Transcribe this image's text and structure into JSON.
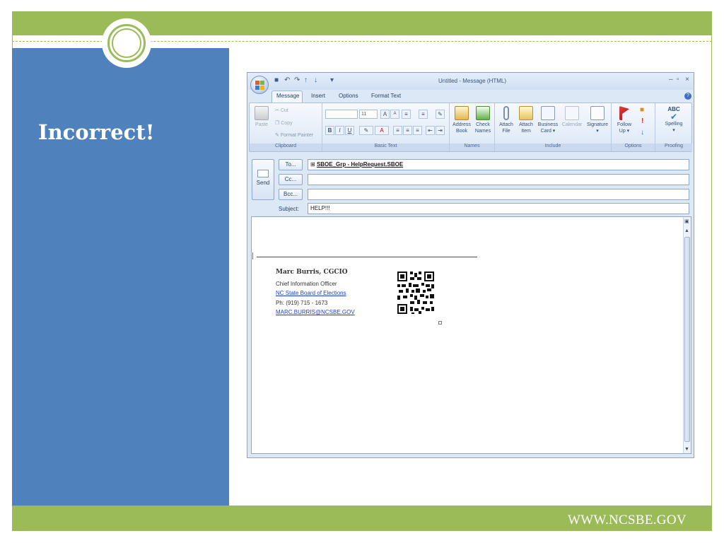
{
  "slide": {
    "title": "Incorrect!",
    "footer_url": "WWW.NCSBE.GOV",
    "colors": {
      "green": "#9bbb59",
      "blue": "#4f81bd"
    }
  },
  "window": {
    "title": "Untitled - Message (HTML)",
    "controls": {
      "minimize": "–",
      "maximize": "▫",
      "close": "×"
    }
  },
  "tabs": [
    {
      "label": "Message",
      "active": true
    },
    {
      "label": "Insert"
    },
    {
      "label": "Options"
    },
    {
      "label": "Format Text"
    }
  ],
  "ribbon": {
    "clipboard": {
      "label": "Clipboard",
      "paste": "Paste",
      "cut": "Cut",
      "copy": "Copy",
      "format_painter": "Format Painter"
    },
    "basic_text": {
      "label": "Basic Text",
      "font_size": "11"
    },
    "names": {
      "label": "Names",
      "address_book_1": "Address",
      "address_book_2": "Book",
      "check_names_1": "Check",
      "check_names_2": "Names"
    },
    "include": {
      "label": "Include",
      "attach_file_1": "Attach",
      "attach_file_2": "File",
      "attach_item_1": "Attach",
      "attach_item_2": "Item",
      "business_card_1": "Business",
      "business_card_2": "Card",
      "calendar": "Calendar",
      "signature": "Signature"
    },
    "options": {
      "label": "Options",
      "follow_up_1": "Follow",
      "follow_up_2": "Up"
    },
    "proofing": {
      "label": "Proofing",
      "spelling": "Spelling",
      "abc": "ABC"
    }
  },
  "header": {
    "send": "Send",
    "to_button": "To...",
    "cc_button": "Cc...",
    "bcc_button": "Bcc...",
    "subject_label": "Subject:",
    "to_value": "SBOE_Grp - HelpRequest.SBOE",
    "cc_value": "",
    "bcc_value": "",
    "subject_value": "HELP!!!"
  },
  "signature": {
    "name": "Marc Burris, CGCIO",
    "title": "Chief Information Officer",
    "org_link": "NC State Board of Elections",
    "phone": "Ph: (919) 715 - 1673",
    "email": "MARC.BURRIS@NCSBE.GOV"
  }
}
